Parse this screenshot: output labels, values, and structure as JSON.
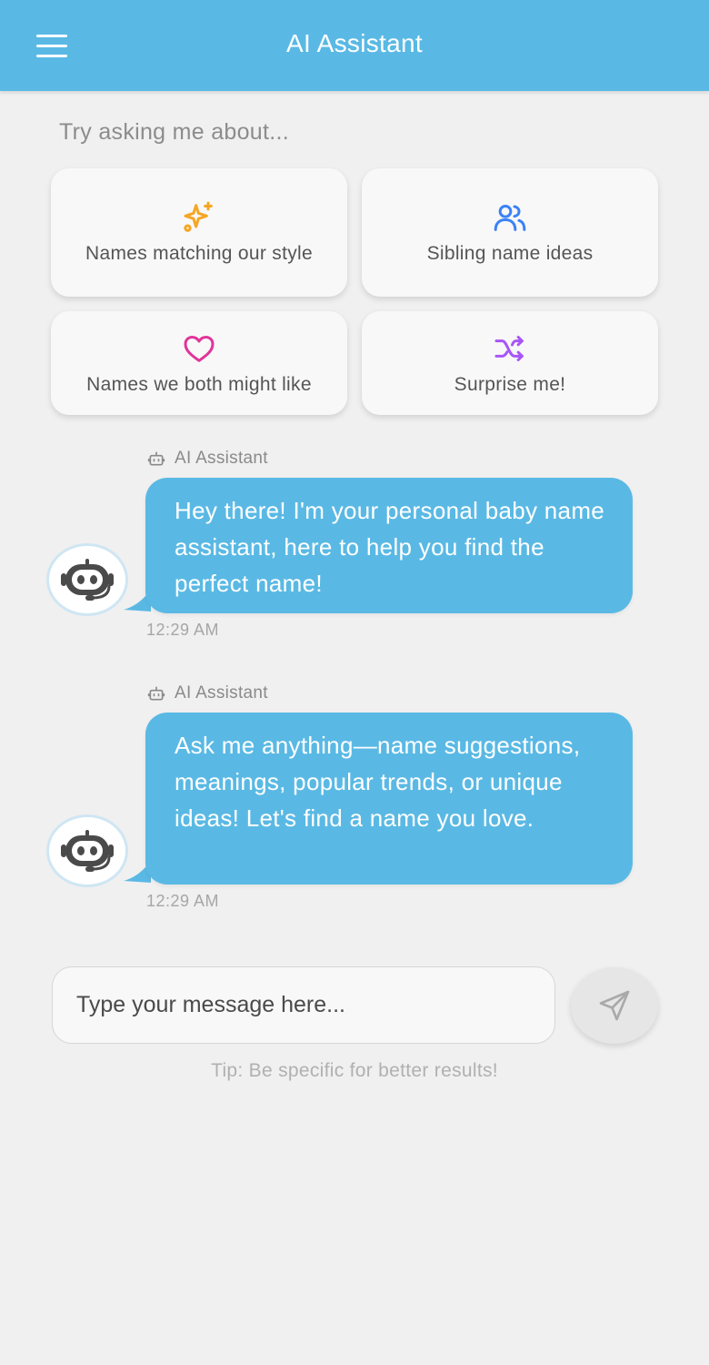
{
  "header": {
    "title": "AI Assistant",
    "menu_icon": "menu-icon"
  },
  "suggestions": {
    "heading": "Try asking me about...",
    "cards": [
      {
        "label": "Names matching our style",
        "icon": "sparkles-icon",
        "color": "#f5a623"
      },
      {
        "label": "Sibling name ideas",
        "icon": "users-icon",
        "color": "#3b82f6"
      },
      {
        "label": "Names we both might like",
        "icon": "heart-icon",
        "color": "#e0349b"
      },
      {
        "label": "Surprise me!",
        "icon": "shuffle-icon",
        "color": "#a855f7"
      }
    ]
  },
  "messages": [
    {
      "sender": "AI Assistant",
      "text": " Hey there!  I'm your personal baby name assistant, here to help you find the perfect name!",
      "time": "12:29 AM"
    },
    {
      "sender": "AI Assistant",
      "text": " Ask me anything—name suggestions, meanings, popular trends, or unique ideas! Let's find a name you love.",
      "time": "12:29 AM"
    }
  ],
  "composer": {
    "placeholder": "Type your message here...",
    "send_icon": "send-icon",
    "tip": "Tip: Be specific for better results!"
  },
  "colors": {
    "accent": "#5ab9e4",
    "background": "#f0f0f0"
  }
}
